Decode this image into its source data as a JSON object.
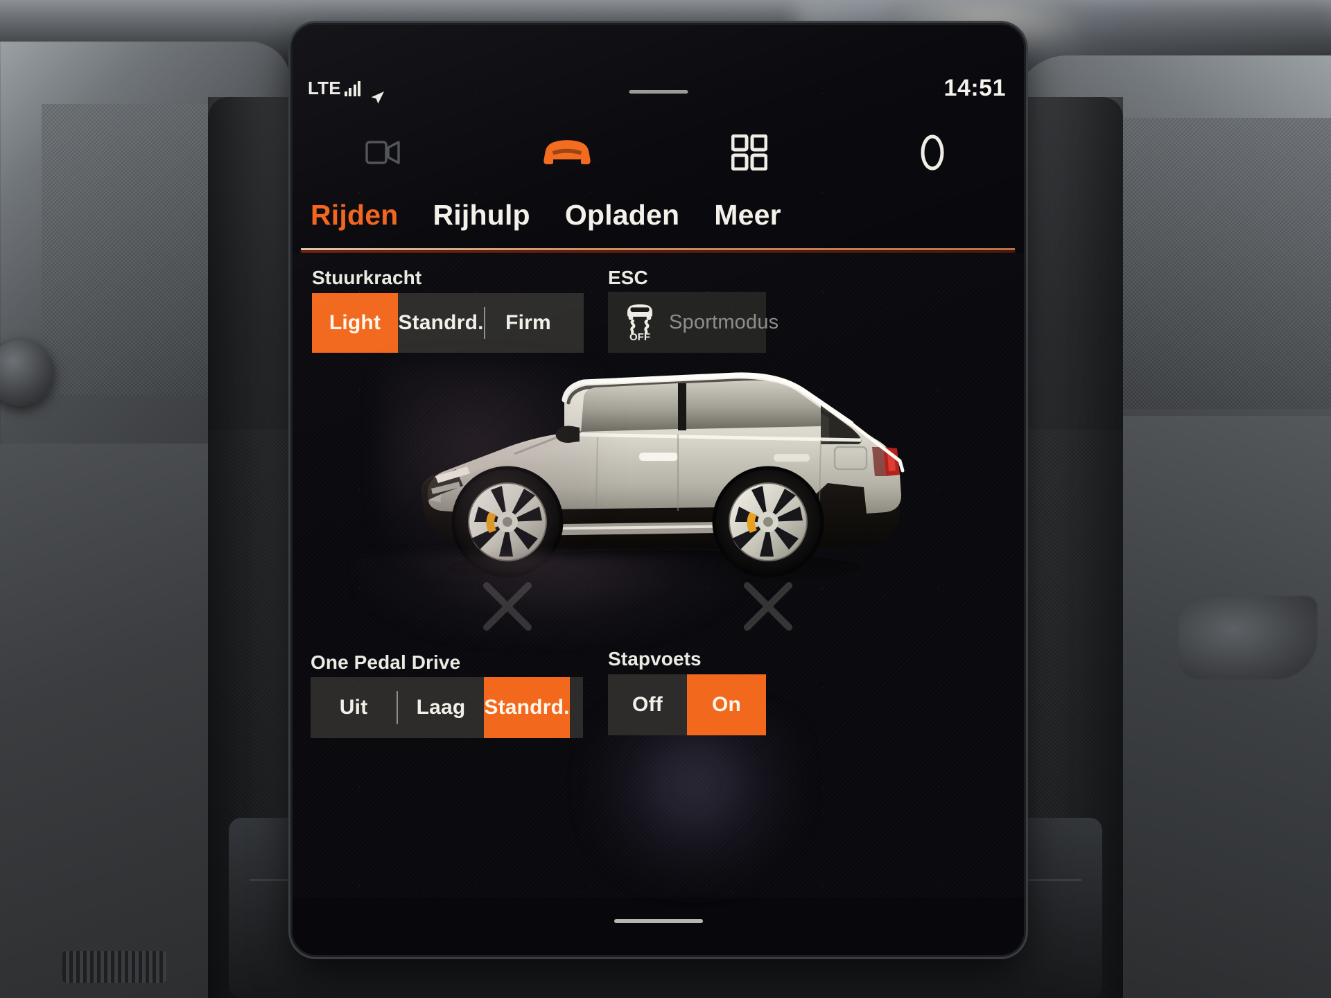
{
  "status_bar": {
    "network_label": "LTE",
    "signal_icon": "signal-bars-icon",
    "location_icon": "navigation-arrow-icon",
    "handle_icon": "drag-handle-pill",
    "time": "14:51"
  },
  "icon_bar": {
    "items": [
      {
        "name": "camera-icon",
        "label": "Camera",
        "active": false
      },
      {
        "name": "car-icon",
        "label": "Auto",
        "active": true
      },
      {
        "name": "apps-grid-icon",
        "label": "Apps",
        "active": false
      },
      {
        "name": "profile-icon",
        "label": "Profiel",
        "active": false
      }
    ]
  },
  "tabs": [
    {
      "label": "Rijden",
      "active": true
    },
    {
      "label": "Rijhulp",
      "active": false
    },
    {
      "label": "Opladen",
      "active": false
    },
    {
      "label": "Meer",
      "active": false
    }
  ],
  "sections": {
    "steering": {
      "label": "Stuurkracht",
      "options": [
        {
          "label": "Light",
          "selected": true
        },
        {
          "label": "Standrd.",
          "selected": false
        },
        {
          "label": "Firm",
          "selected": false
        }
      ]
    },
    "esc": {
      "label": "ESC",
      "tile": {
        "icon": "esc-off-icon",
        "icon_text": "OFF",
        "label": "Sportmodus",
        "active": false
      }
    },
    "one_pedal_drive": {
      "label": "One Pedal Drive",
      "options": [
        {
          "label": "Uit",
          "selected": false
        },
        {
          "label": "Laag",
          "selected": false
        },
        {
          "label": "Standrd.",
          "selected": true
        }
      ]
    },
    "creep": {
      "label": "Stapvoets",
      "options": [
        {
          "label": "Off",
          "selected": false
        },
        {
          "label": "On",
          "selected": true
        }
      ]
    }
  },
  "hero": {
    "name": "vehicle-side-view",
    "description": "Polestar 2 side profile render"
  },
  "colors": {
    "accent_orange": "#f2691e",
    "accent_orange_text": "#f2631c",
    "screen_background": "#0a0a0e",
    "panel_tile": "#2d2c2a",
    "esc_tile": "#232321",
    "text_primary": "#f2efe9",
    "text_muted": "#8f8d89"
  }
}
